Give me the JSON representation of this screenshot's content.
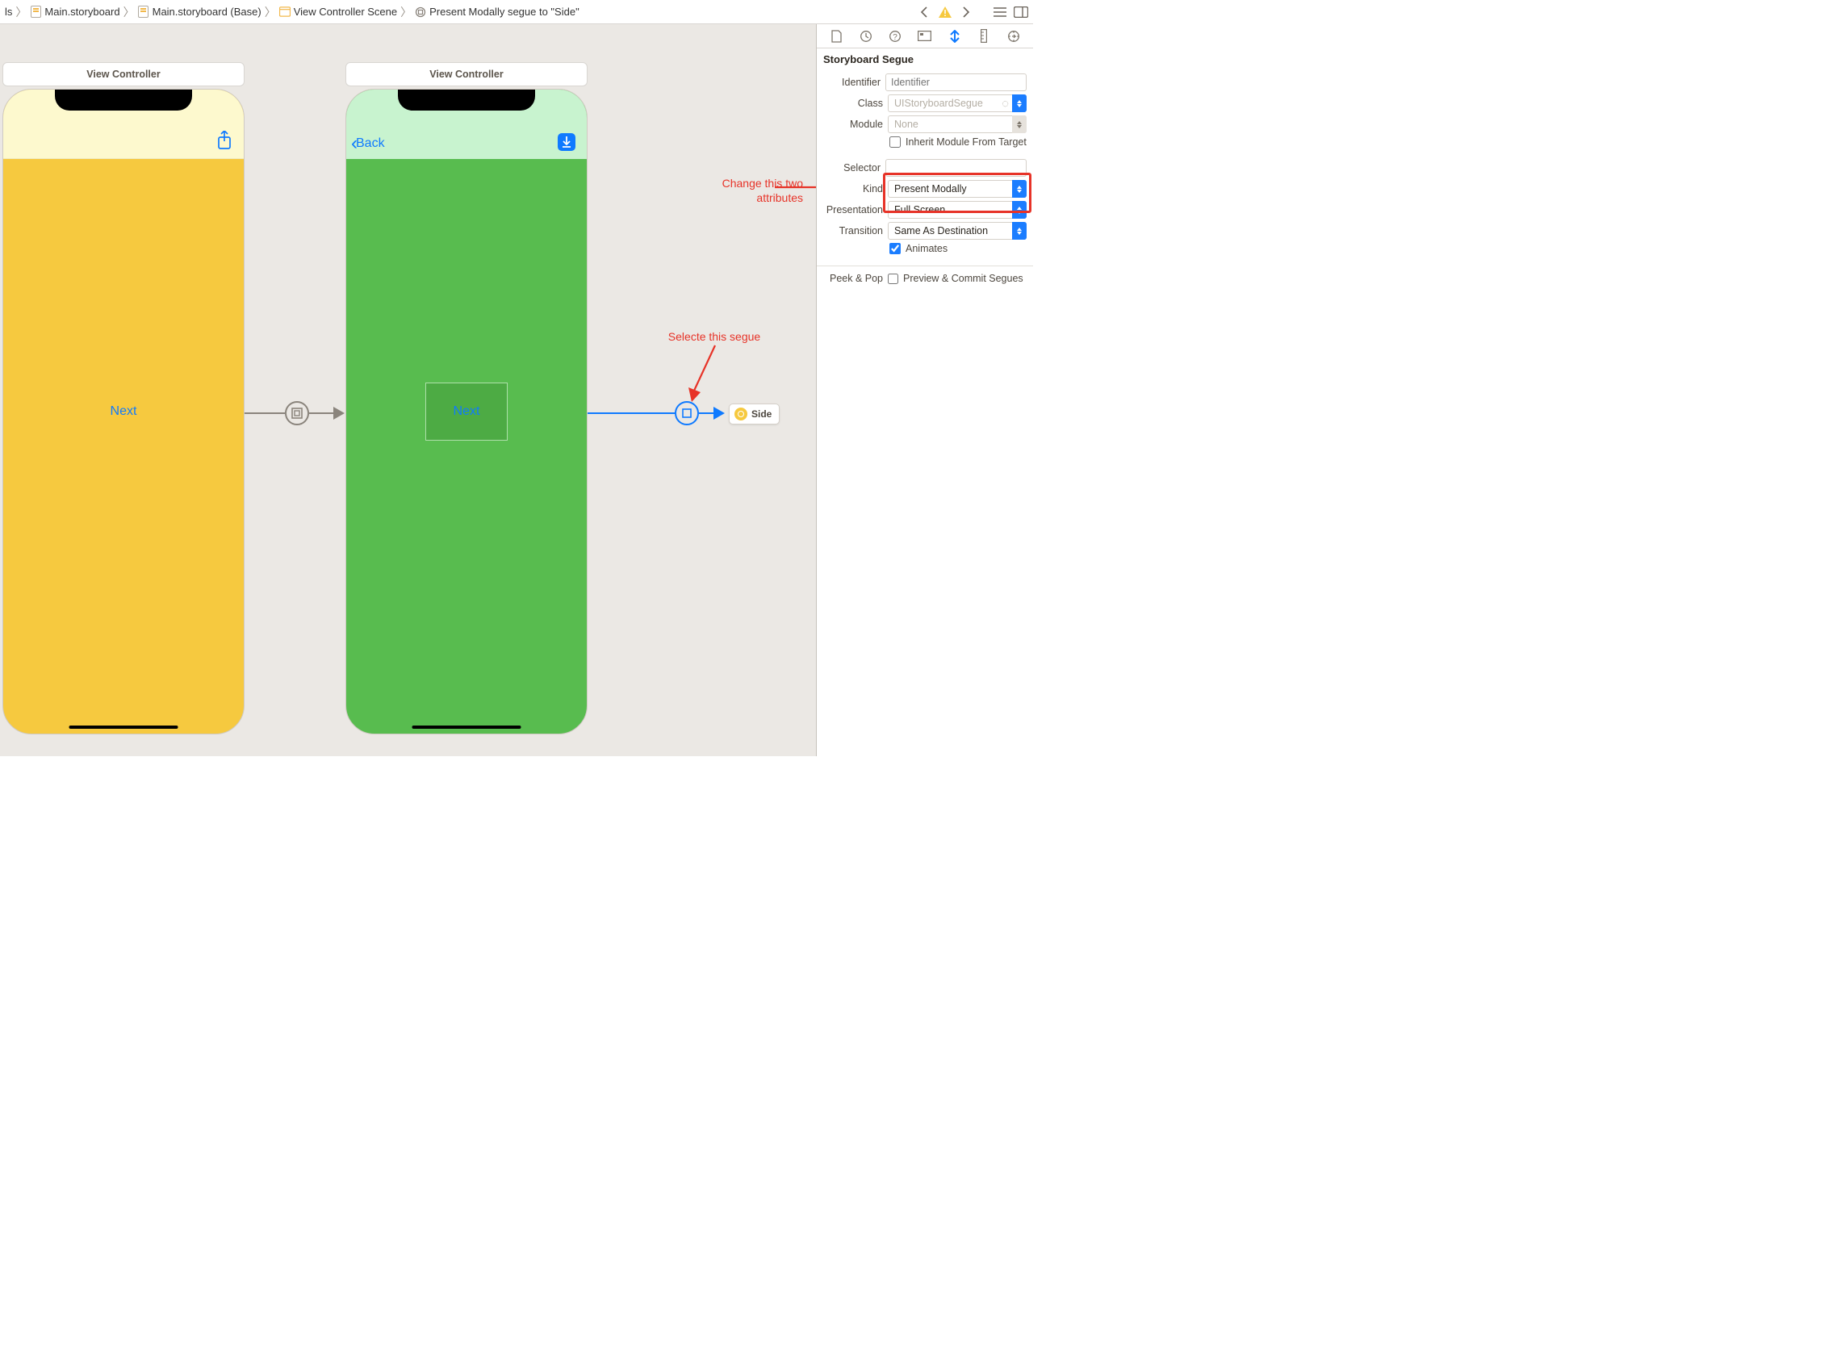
{
  "breadcrumb": {
    "items": [
      {
        "label": "ls"
      },
      {
        "label": "Main.storyboard"
      },
      {
        "label": "Main.storyboard (Base)"
      },
      {
        "label": "View Controller Scene"
      },
      {
        "label": "Present Modally segue to \"Side\""
      }
    ]
  },
  "scenes": {
    "left": {
      "title": "View Controller",
      "button": "Next"
    },
    "right": {
      "title": "View Controller",
      "back": "Back",
      "button": "Next"
    }
  },
  "dest_node": {
    "label": "Side"
  },
  "annotations": {
    "attrs": "Change this two\nattributes",
    "segue": "Selecte this segue"
  },
  "inspector": {
    "section_title": "Storyboard Segue",
    "identifier": {
      "label": "Identifier",
      "value": "",
      "placeholder": "Identifier"
    },
    "klass": {
      "label": "Class",
      "value": "UIStoryboardSegue"
    },
    "module": {
      "label": "Module",
      "value": "None"
    },
    "inherit": {
      "label": "Inherit Module From Target",
      "checked": false
    },
    "selector": {
      "label": "Selector",
      "value": ""
    },
    "kind": {
      "label": "Kind",
      "value": "Present Modally"
    },
    "presentation": {
      "label": "Presentation",
      "value": "Full Screen"
    },
    "transition": {
      "label": "Transition",
      "value": "Same As Destination"
    },
    "animates": {
      "label": "Animates",
      "checked": true
    },
    "peek": {
      "label": "Peek & Pop",
      "option": "Preview & Commit Segues",
      "checked": false
    }
  }
}
